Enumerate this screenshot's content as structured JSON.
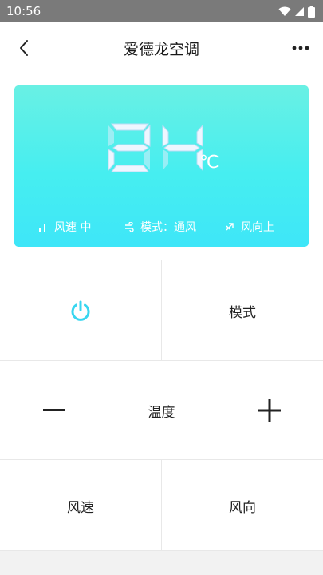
{
  "status_bar": {
    "time": "10:56",
    "icons": [
      "wifi-icon",
      "signal-icon",
      "battery-icon"
    ]
  },
  "header": {
    "title": "爱德龙空调",
    "back_icon": "chevron-left-icon",
    "more_icon": "more-dots-icon"
  },
  "display": {
    "temperature": "24",
    "unit": "℃",
    "fan_speed": "风速 中",
    "mode": "模式：通风",
    "direction": "风向上",
    "colors": {
      "gradient_top": "#69f0e4",
      "gradient_bottom": "#3ee6f8"
    }
  },
  "controls": {
    "power_icon": "power-icon",
    "mode_label": "模式",
    "temp_label": "温度",
    "fan_label": "风速",
    "direction_label": "风向",
    "accent": "#38d6f0"
  }
}
